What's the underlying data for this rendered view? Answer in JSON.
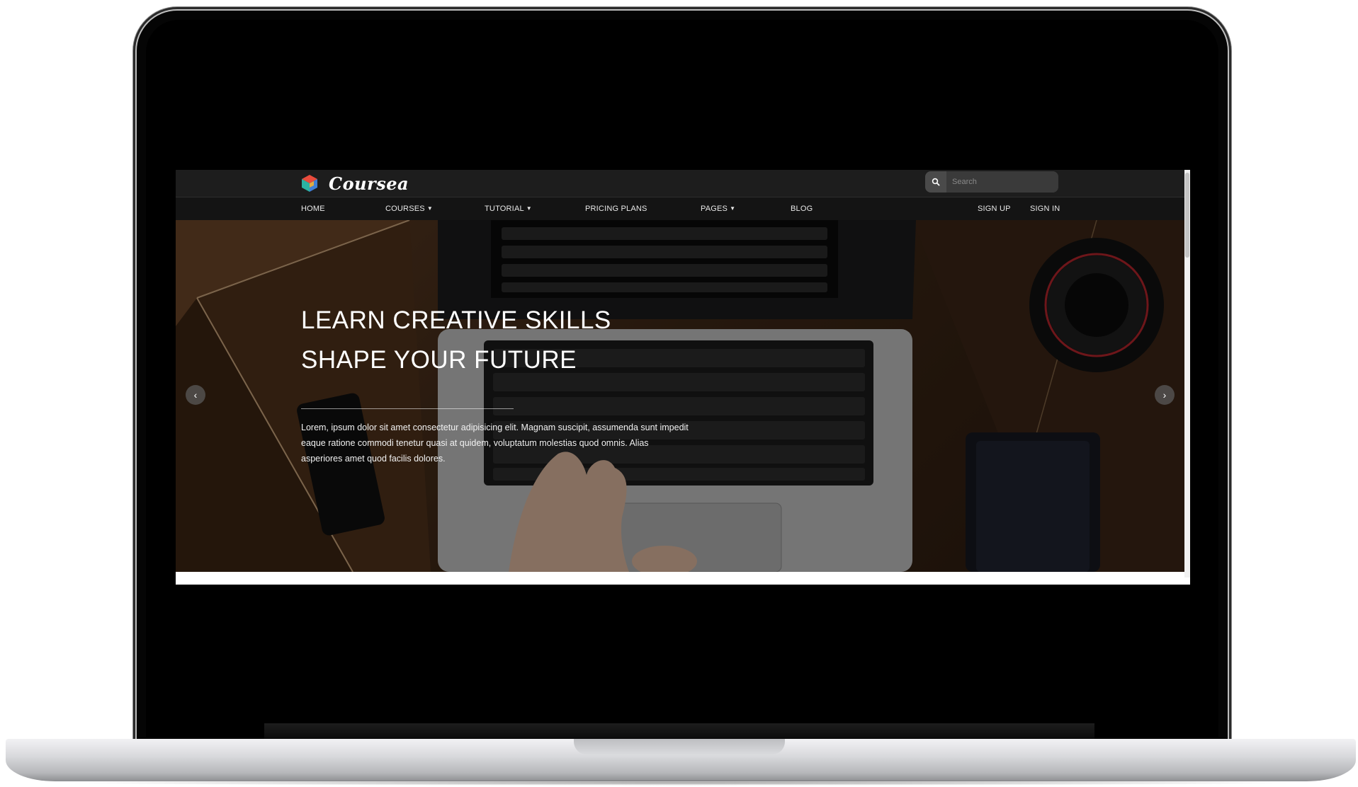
{
  "brand": {
    "name": "Coursea",
    "logo_icon": "hexagon-cube-icon"
  },
  "search": {
    "placeholder": "Search",
    "icon": "search-icon"
  },
  "nav": {
    "items": [
      {
        "label": "HOME"
      },
      {
        "label": "COURSES",
        "dropdown": true
      },
      {
        "label": "TUTORIAL",
        "dropdown": true
      },
      {
        "label": "PRICING PLANS"
      },
      {
        "label": "PAGES",
        "dropdown": true
      },
      {
        "label": "BLOG"
      }
    ],
    "sign_up": "SIGN UP",
    "sign_in": "SIGN IN"
  },
  "hero": {
    "title_line1": "LEARN CREATIVE SKILLS",
    "title_line2": "SHAPE YOUR FUTURE",
    "text": "Lorem, ipsum dolor sit amet consectetur adipisicing elit. Magnam suscipit, assumenda sunt impedit eaque ratione commodi tenetur quasi at quidem, voluptatum molestias quod omnis. Alias asperiores amet quod facilis dolores.",
    "prev_arrow": "‹",
    "next_arrow": "›"
  },
  "colors": {
    "topbar": "#1d1d1d",
    "navbar": "#141414",
    "logo": [
      "#e94b3c",
      "#2bb3a3",
      "#f2b233",
      "#3e7fd6"
    ]
  }
}
